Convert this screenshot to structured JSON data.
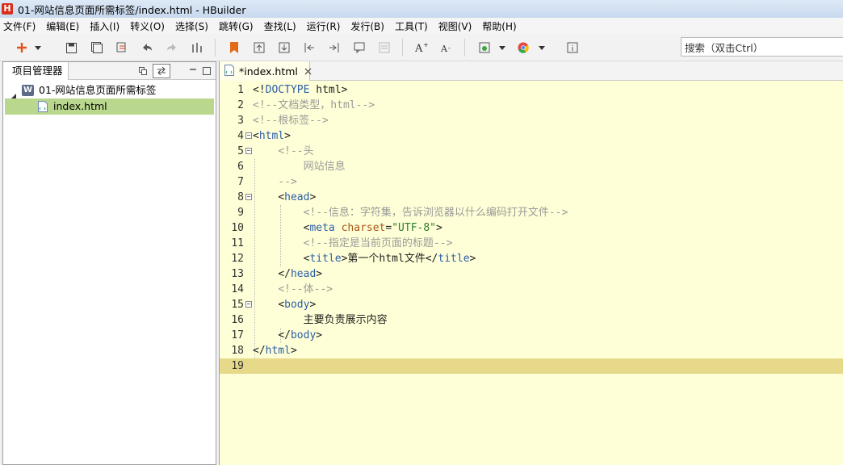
{
  "titlebar": {
    "title": "01-网站信息页面所需标签/index.html  -  HBuilder"
  },
  "menu": [
    "文件(F)",
    "编辑(E)",
    "插入(I)",
    "转义(O)",
    "选择(S)",
    "跳转(G)",
    "查找(L)",
    "运行(R)",
    "发行(B)",
    "工具(T)",
    "视图(V)",
    "帮助(H)"
  ],
  "search": {
    "placeholder": "搜索（双击Ctrl）"
  },
  "project_panel": {
    "tab_label": "项目管理器",
    "tree": [
      {
        "label": "01-网站信息页面所需标签",
        "type": "project",
        "expanded": true
      },
      {
        "label": "index.html",
        "type": "file",
        "selected": true
      }
    ]
  },
  "editor": {
    "tab_label": "*index.html",
    "current_line": 19,
    "lines": [
      {
        "n": "1",
        "text": "<!DOCTYPE html>"
      },
      {
        "n": "2",
        "text": "<!--文档类型，html-->"
      },
      {
        "n": "3",
        "text": "<!--根标签-->"
      },
      {
        "n": "4",
        "text": "<html>"
      },
      {
        "n": "5",
        "text": "    <!--头"
      },
      {
        "n": "6",
        "text": "        网站信息"
      },
      {
        "n": "7",
        "text": "    -->"
      },
      {
        "n": "8",
        "text": "    <head>"
      },
      {
        "n": "9",
        "text": "        <!--信息：字符集，告诉浏览器以什么编码打开文件-->"
      },
      {
        "n": "10",
        "text": "        <meta charset=\"UTF-8\">"
      },
      {
        "n": "11",
        "text": "        <!--指定是当前页面的标题-->"
      },
      {
        "n": "12",
        "text": "        <title>第一个html文件</title>"
      },
      {
        "n": "13",
        "text": "    </head>"
      },
      {
        "n": "14",
        "text": "    <!--体-->"
      },
      {
        "n": "15",
        "text": "    <body>"
      },
      {
        "n": "16",
        "text": "        主要负责展示内容"
      },
      {
        "n": "17",
        "text": "    </body>"
      },
      {
        "n": "18",
        "text": "</html>"
      },
      {
        "n": "19",
        "text": ""
      }
    ]
  },
  "colors": {
    "editor_bg": "#ffffd7",
    "current_line": "#e6d98a",
    "selected_tree": "#bad88d",
    "tag": "#2a5ea8",
    "comment": "#9a9a9a",
    "attr": "#a55515",
    "string": "#2c7d2c"
  }
}
